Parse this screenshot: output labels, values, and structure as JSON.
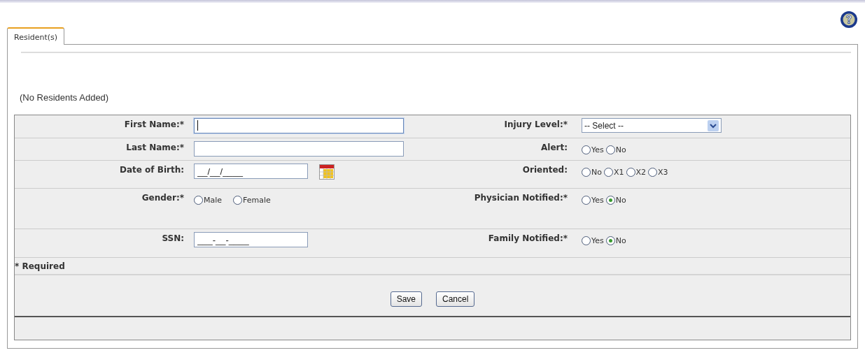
{
  "tabs": [
    {
      "label": "Resident(s)",
      "selected": true
    }
  ],
  "empty_message": "(No Residents Added)",
  "rows": [
    {
      "left": {
        "label": "First Name:*",
        "kind": "text",
        "focused": true
      },
      "right": {
        "label": "Injury Level:*",
        "kind": "select",
        "value": "-- Select --"
      }
    },
    {
      "left": {
        "label": "Last Name:*",
        "kind": "text",
        "focused": false
      },
      "right": {
        "label": "Alert:",
        "kind": "radio",
        "options": [
          {
            "label": "Yes",
            "selected": false
          },
          {
            "label": "No",
            "selected": false
          }
        ]
      }
    },
    {
      "left": {
        "label": "Date of Birth:",
        "kind": "date",
        "value": "__/__/____"
      },
      "right": {
        "label": "Oriented:",
        "kind": "radio",
        "options": [
          {
            "label": "No",
            "selected": false
          },
          {
            "label": "X1",
            "selected": false
          },
          {
            "label": "X2",
            "selected": false
          },
          {
            "label": "X3",
            "selected": false
          }
        ]
      }
    },
    {
      "left": {
        "label": "Gender:*",
        "kind": "radio",
        "options": [
          {
            "label": "Male",
            "selected": false
          },
          {
            "label": "Female",
            "selected": false
          }
        ]
      },
      "right": {
        "label": "Physician Notified:*",
        "kind": "radio",
        "options": [
          {
            "label": "Yes",
            "selected": false
          },
          {
            "label": "No",
            "selected": true
          }
        ]
      }
    },
    {
      "left": {
        "label": "SSN:",
        "kind": "short",
        "value": "___-__-____"
      },
      "right": {
        "label": "Family Notified:*",
        "kind": "radio",
        "options": [
          {
            "label": "Yes",
            "selected": false
          },
          {
            "label": "No",
            "selected": true
          }
        ]
      }
    }
  ],
  "required_note": "* Required",
  "buttons": [
    "Save",
    "Cancel"
  ]
}
